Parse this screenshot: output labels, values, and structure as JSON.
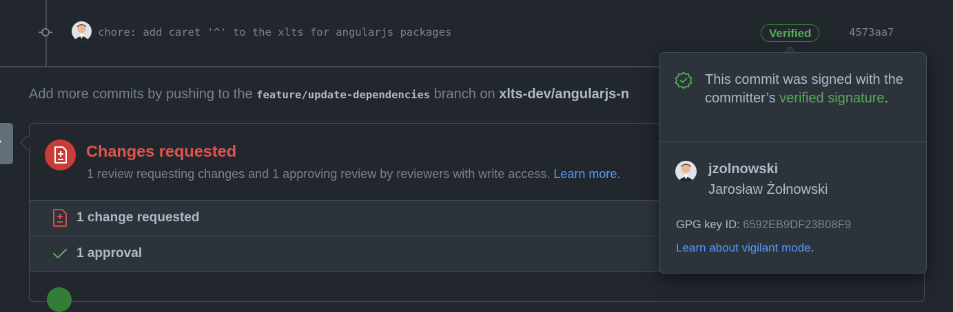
{
  "commit": {
    "message": "chore: add caret '^' to the xlts for angularjs packages",
    "verified_label": "Verified",
    "sha": "4573aa7"
  },
  "push_hint": {
    "prefix": "Add more commits by pushing to the ",
    "branch": "feature/update-dependencies",
    "middle": " branch on ",
    "repo": "xlts-dev/angularjs-n"
  },
  "merge_box": {
    "title": "Changes requested",
    "subtitle": "1 review requesting changes and 1 approving review by reviewers with write access.",
    "learn_more": "Learn more.",
    "change_requested_label": "1 change requested",
    "approval_label": "1 approval"
  },
  "popover": {
    "signed_prefix": "This commit was signed with the committer’s ",
    "signed_link": "verified signature",
    "signed_suffix": ".",
    "login": "jzolnowski",
    "full_name": "Jarosław Żołnowski",
    "gpg_label": "GPG key ID: ",
    "gpg_key": "6592EB9DF23B08F9",
    "vigilant_link": "Learn about vigilant mode",
    "vigilant_suffix": "."
  },
  "colors": {
    "background": "#22272e",
    "verified_green": "#57ab5a",
    "danger_red": "#e5534b",
    "link_blue": "#539bf5"
  },
  "icons": {
    "commit": "git-commit-icon",
    "review_requested": "file-diff-icon",
    "approval": "check-icon",
    "verified_signature": "verified-shield-icon"
  }
}
